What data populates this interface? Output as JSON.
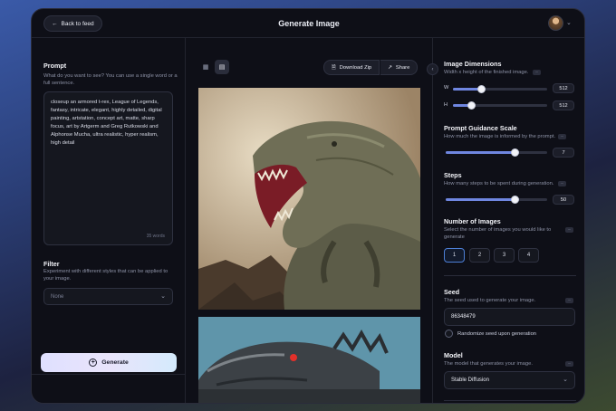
{
  "header": {
    "back_label": "Back to feed",
    "title": "Generate Image"
  },
  "left": {
    "prompt_label": "Prompt",
    "prompt_help": "What do you want to see? You can use a single word or a full sentence.",
    "prompt_text": "closeup an armored t-rex, League of Legends, fantasy, intricate, elegant, highly detailed, digital painting, artstation, concept art, matte, sharp focus, art by Artgerm and Greg Rutkowski and Alphonse Mucha, ultra realistic, hyper realism, high detail",
    "word_count": "35 words",
    "filter_label": "Filter",
    "filter_help": "Experiment with different styles that can be applied to your image.",
    "filter_value": "None",
    "generate_label": "Generate"
  },
  "center": {
    "download_label": "Download Zip",
    "share_label": "Share"
  },
  "right": {
    "dimensions_label": "Image Dimensions",
    "dimensions_help": "Width x height of the finished image.",
    "width_axis": "W",
    "width_value": "512",
    "height_axis": "H",
    "height_value": "512",
    "guidance_label": "Prompt Guidance Scale",
    "guidance_help": "How much the image is informed by the prompt.",
    "guidance_value": "7",
    "steps_label": "Steps",
    "steps_help": "How many steps to be spent during generation.",
    "steps_value": "50",
    "num_images_label": "Number of Images",
    "num_images_help": "Select the number of images you would like to generate",
    "num_options": [
      "1",
      "2",
      "3",
      "4"
    ],
    "num_selected": "1",
    "seed_label": "Seed",
    "seed_help": "The seed used to generate your image.",
    "seed_value": "86348479",
    "randomize_label": "Randomize seed upon generation",
    "model_label": "Model",
    "model_help": "The model that generates your image.",
    "model_value": "Stable Diffusion"
  },
  "sliders": {
    "width_fraction": 0.3,
    "height_fraction": 0.2,
    "guidance_fraction": 0.68,
    "steps_fraction": 0.68
  },
  "colors": {
    "accent": "#6f86e0",
    "panel_bg": "#0e0f17",
    "selected_border": "#4d7fd6"
  }
}
